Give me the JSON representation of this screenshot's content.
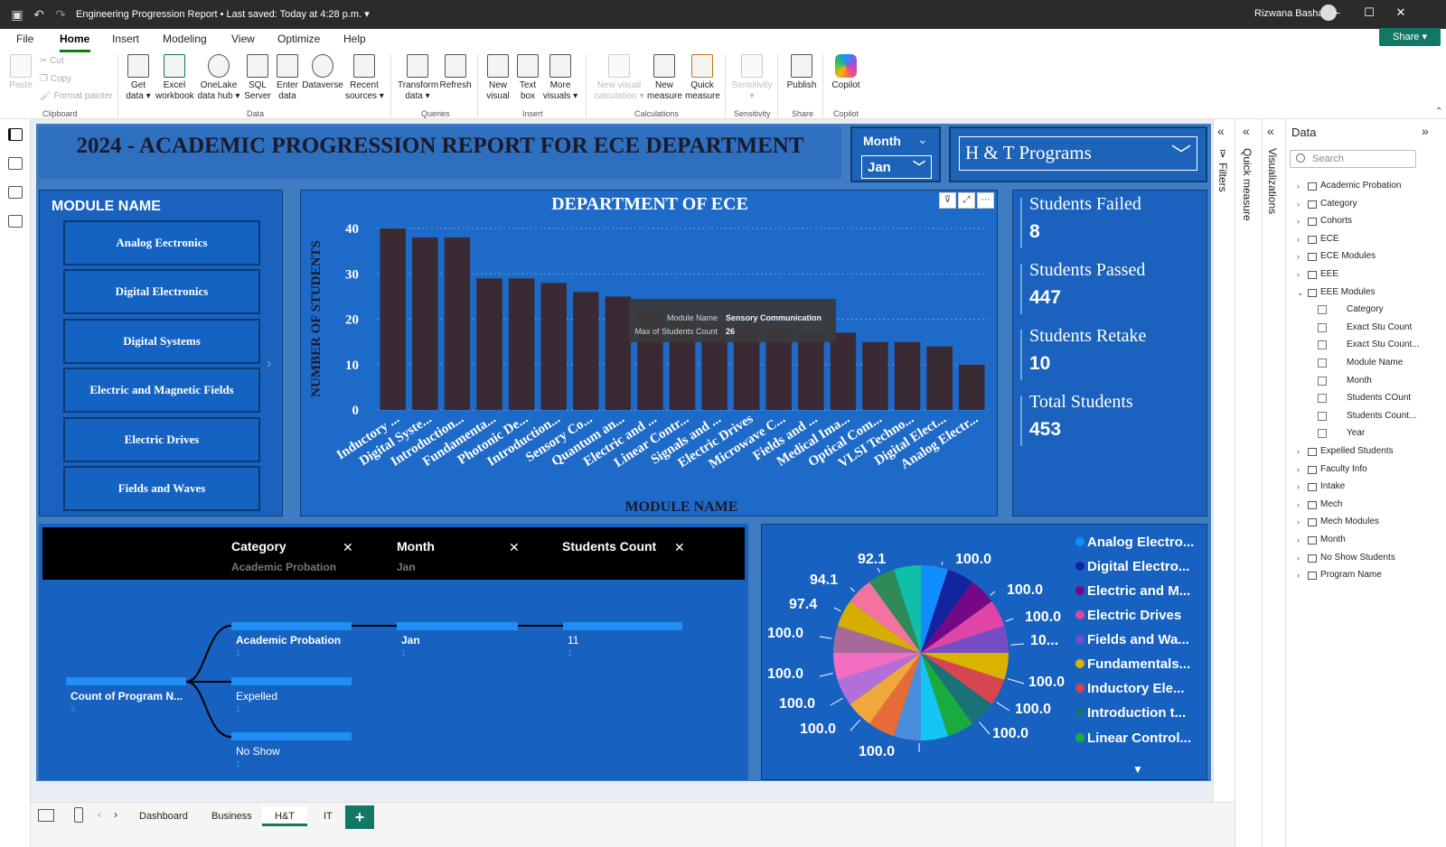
{
  "titlebar": {
    "document_title": "Engineering Progression Report • Last saved: Today at 4:28 p.m.",
    "user_name": "Rizwana Basha"
  },
  "menu": {
    "items": [
      "File",
      "Home",
      "Insert",
      "Modeling",
      "View",
      "Optimize",
      "Help"
    ],
    "active": "Home",
    "share_label": "Share"
  },
  "ribbon": {
    "clipboard": {
      "paste": "Paste",
      "cut": "Cut",
      "copy": "Copy",
      "format_painter": "Format painter",
      "group": "Clipboard"
    },
    "data_buttons": [
      {
        "l1": "Get",
        "l2": "data ▾"
      },
      {
        "l1": "Excel",
        "l2": "workbook"
      },
      {
        "l1": "OneLake",
        "l2": "data hub ▾"
      },
      {
        "l1": "SQL",
        "l2": "Server"
      },
      {
        "l1": "Enter",
        "l2": "data"
      },
      {
        "l1": "Dataverse",
        "l2": ""
      },
      {
        "l1": "Recent",
        "l2": "sources ▾"
      }
    ],
    "data_group": "Data",
    "queries_buttons": [
      {
        "l1": "Transform",
        "l2": "data ▾"
      },
      {
        "l1": "Refresh",
        "l2": ""
      }
    ],
    "queries_group": "Queries",
    "insert_buttons": [
      {
        "l1": "New",
        "l2": "visual"
      },
      {
        "l1": "Text",
        "l2": "box"
      },
      {
        "l1": "More",
        "l2": "visuals ▾"
      }
    ],
    "insert_group": "Insert",
    "calc_buttons": [
      {
        "l1": "New visual",
        "l2": "calculation ▾"
      },
      {
        "l1": "New",
        "l2": "measure"
      },
      {
        "l1": "Quick",
        "l2": "measure"
      }
    ],
    "calc_group": "Calculations",
    "sensitivity_button": {
      "l1": "Sensitivity",
      "l2": "▾"
    },
    "sensitivity_group": "Sensitivity",
    "publish_button": "Publish",
    "share_group": "Share",
    "copilot_button": "Copilot",
    "copilot_group": "Copilot"
  },
  "report": {
    "title": "2024 - ACADEMIC PROGRESSION REPORT FOR ECE DEPARTMENT",
    "month_slicer": {
      "title": "Month",
      "value": "Jan"
    },
    "program_slicer": {
      "value": "H & T Programs"
    },
    "module_panel": {
      "title": "MODULE NAME",
      "buttons": [
        "Analog Eectronics",
        "Digital Electronics",
        "Digital Systems",
        "Electric and Magnetic Fields",
        "Electric Drives",
        "Fields and Waves"
      ]
    },
    "kpis": [
      {
        "label": "Students Failed",
        "value": "8"
      },
      {
        "label": "Students Passed",
        "value": "447"
      },
      {
        "label": "Students Retake",
        "value": "10"
      },
      {
        "label": "Total Students",
        "value": "453"
      }
    ],
    "tooltip": {
      "k1": "Module Name",
      "v1": "Sensory Communication",
      "k2": "Max of Students Count",
      "v2": "26"
    },
    "decomposition": {
      "headers": [
        {
          "title": "Category",
          "sub": "Academic Probation"
        },
        {
          "title": "Month",
          "sub": "Jan"
        },
        {
          "title": "Students Count",
          "sub": ""
        }
      ],
      "root": {
        "label": "Count of Program N...",
        "value": "3"
      },
      "categories": [
        {
          "label": "Academic Probation",
          "value": "1"
        },
        {
          "label": "Expelled",
          "value": "1"
        },
        {
          "label": "No Show",
          "value": "1"
        }
      ],
      "month": {
        "label": "Jan",
        "value": "1"
      },
      "count": {
        "label": "11",
        "value": "1"
      }
    },
    "pie": {
      "labels": [
        "92.1",
        "100.0",
        "94.1",
        "100.0",
        "97.4",
        "100.0",
        "100.0",
        "10...",
        "100.0",
        "100.0",
        "100.0",
        "100.0",
        "100.0",
        "100.0",
        "100.0",
        "100.0"
      ],
      "legend": [
        {
          "name": "Analog Electro...",
          "color": "#118dff"
        },
        {
          "name": "Digital Electro...",
          "color": "#12239e"
        },
        {
          "name": "Electric and M...",
          "color": "#750985"
        },
        {
          "name": "Electric Drives",
          "color": "#e044a7"
        },
        {
          "name": "Fields and Wa...",
          "color": "#744ec2"
        },
        {
          "name": "Fundamentals...",
          "color": "#d9b300"
        },
        {
          "name": "Inductory Ele...",
          "color": "#d64550"
        },
        {
          "name": "Introduction t...",
          "color": "#197278"
        },
        {
          "name": "Linear Control...",
          "color": "#1aab40"
        }
      ]
    }
  },
  "chart_data": {
    "type": "bar",
    "title": "DEPARTMENT OF ECE",
    "xlabel": "MODULE NAME",
    "ylabel": "NUMBER OF STUDENTS",
    "ylim": [
      0,
      40
    ],
    "yticks": [
      0,
      10,
      20,
      30,
      40
    ],
    "categories": [
      "Inductory ...",
      "Digital Syste...",
      "Introduction...",
      "Fundamenta...",
      "Photonic De...",
      "Introduction...",
      "Sensory Co...",
      "Quantum an...",
      "Electric and ...",
      "Linear Contr...",
      "Signals and ...",
      "Electric Drives",
      "Microwave C...",
      "Fields and ...",
      "Medical Ima...",
      "Optical Com...",
      "VLSI Techno...",
      "Digital Elect...",
      "Analog Electr..."
    ],
    "values": [
      40,
      38,
      38,
      29,
      29,
      28,
      26,
      25,
      22,
      20,
      19,
      19,
      18,
      17,
      17,
      15,
      15,
      14,
      10
    ],
    "bar_color": "#3a2a33"
  },
  "pie_data": {
    "type": "pie",
    "slice_colors": [
      "#118dff",
      "#12239e",
      "#750985",
      "#e044a7",
      "#744ec2",
      "#d9b300",
      "#d64550",
      "#197278",
      "#1aab40",
      "#15c6f4",
      "#4a8ddc",
      "#e66c37",
      "#f0a73b",
      "#b36fd8",
      "#f36dc0",
      "#a66999",
      "#d4af00",
      "#f472a0",
      "#2e8b57",
      "#11bfa8"
    ]
  },
  "data_pane": {
    "title": "Data",
    "search_placeholder": "Search",
    "tables": [
      "Academic Probation",
      "Category",
      "Cohorts",
      "ECE",
      "ECE Modules",
      "EEE",
      "EEE Modules"
    ],
    "eee_fields": [
      "Category",
      "Exact Stu Count",
      "Exact Stu Count...",
      "Module Name",
      "Month",
      "Students COunt",
      "Students Count...",
      "Year"
    ],
    "tables_after": [
      "Expelled Students",
      "Faculty Info",
      "Intake",
      "Mech",
      "Mech Modules",
      "Month",
      "No Show Students",
      "Program Name"
    ]
  },
  "side": {
    "filters": "Filters",
    "quick_measure": "Quick measure",
    "visualizations": "Visualizations"
  },
  "tabs": [
    "Dashboard",
    "Business",
    "H&T",
    "IT"
  ],
  "active_tab": "H&T"
}
